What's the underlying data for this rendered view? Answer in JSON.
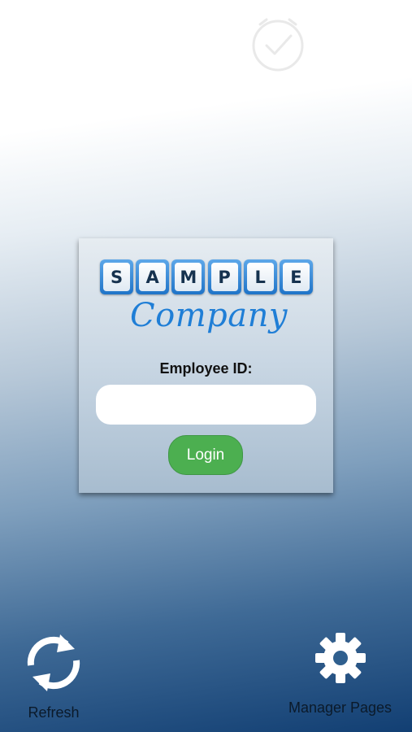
{
  "watermark": {
    "icon": "clock-check-icon"
  },
  "logo": {
    "letters": [
      "S",
      "A",
      "M",
      "P",
      "L",
      "E"
    ],
    "script_text": "Company",
    "colors": {
      "tile_border": "#2b7fd0",
      "script": "#1f7ed6"
    }
  },
  "login_form": {
    "employee_label": "Employee ID:",
    "employee_value": "",
    "login_label": "Login",
    "login_color": "#4caf50"
  },
  "bottom_bar": {
    "refresh": {
      "label": "Refresh",
      "icon": "refresh-icon"
    },
    "manager": {
      "label": "Manager Pages",
      "icon": "gear-icon"
    }
  }
}
